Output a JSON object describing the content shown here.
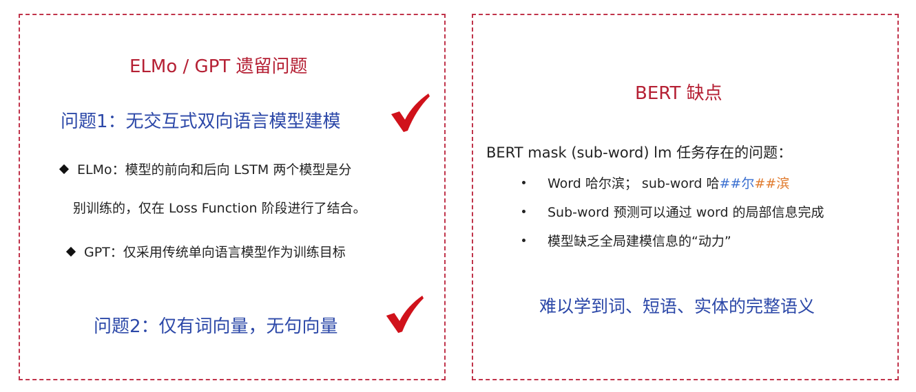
{
  "left": {
    "title": "ELMo / GPT 遗留问题",
    "problem1": "问题1：无交互式双向语言模型建模",
    "bullet_elmo_line1": "ELMo：模型的前向和后向 LSTM 两个模型是分",
    "bullet_elmo_line2": "别训练的，仅在 Loss Function 阶段进行了结合。",
    "bullet_gpt": "GPT：仅采用传统单向语言模型作为训练目标",
    "problem2": "问题2：仅有词向量，无句向量"
  },
  "right": {
    "title": "BERT 缺点",
    "intro": "BERT mask (sub-word) lm 任务存在的问题：",
    "bullet1": {
      "prefix": "Word 哈尔滨； sub-word 哈",
      "hash1": "##",
      "char1": "尔",
      "hash2": "##",
      "char2": "滨"
    },
    "bullet2": "Sub-word 预测可以通过 word 的局部信息完成",
    "bullet3": "模型缺乏全局建模信息的“动力”",
    "conclusion": "难以学到词、短语、实体的完整语义"
  },
  "colors": {
    "border": "#c0334a",
    "title_red": "#b52034",
    "text_blue": "#2c48a8",
    "check_red": "#d0121b",
    "hash_blue": "#3a6fd0",
    "hash_orange": "#e07a2c"
  }
}
